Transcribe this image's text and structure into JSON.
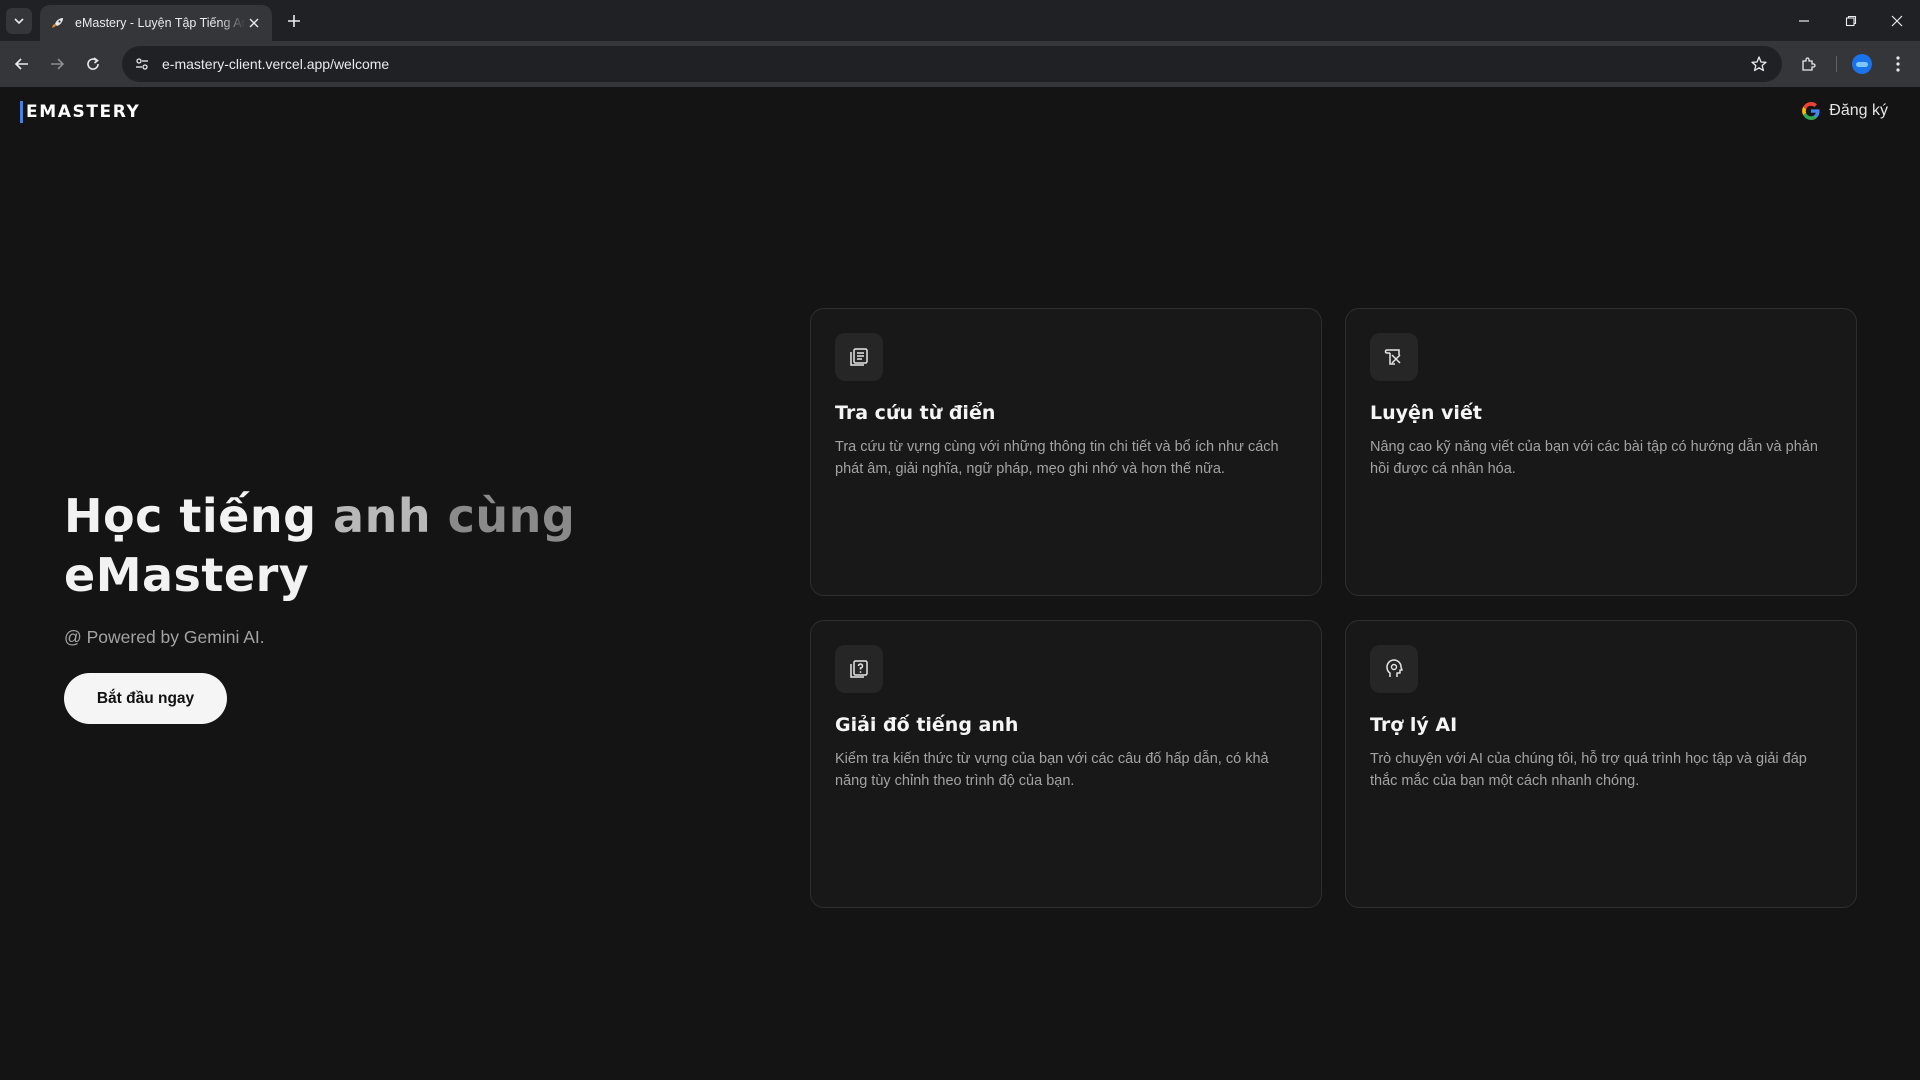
{
  "browser": {
    "tab_title": "eMastery - Luyện Tập Tiếng Anh",
    "url": "e-mastery-client.vercel.app/welcome"
  },
  "header": {
    "logo": "EMASTERY",
    "signup_label": "Đăng ký"
  },
  "hero": {
    "title_part1": "Học tiếng ",
    "title_part2": "anh ",
    "title_part3": "cùng",
    "title_line2": "eMastery",
    "powered": "@ Powered by Gemini AI.",
    "cta_label": "Bắt đầu ngay"
  },
  "features": [
    {
      "icon": "dictionary-icon",
      "title": "Tra cứu từ điển",
      "desc": "Tra cứu từ vựng cùng với những thông tin chi tiết và bổ ích như cách phát âm, giải nghĩa, ngữ pháp, mẹo ghi nhớ và hơn thế nữa."
    },
    {
      "icon": "writing-icon",
      "title": "Luyện viết",
      "desc": "Nâng cao kỹ năng viết của bạn với các bài tập có hướng dẫn và phản hồi được cá nhân hóa."
    },
    {
      "icon": "quiz-icon",
      "title": "Giải đố tiếng anh",
      "desc": "Kiểm tra kiến thức từ vựng của bạn với các câu đố hấp dẫn, có khả năng tùy chỉnh theo trình độ của bạn."
    },
    {
      "icon": "ai-assistant-icon",
      "title": "Trợ lý AI",
      "desc": "Trò chuyện với AI của chúng tôi, hỗ trợ quá trình học tập và giải đáp thắc mắc của bạn một cách nhanh chóng."
    }
  ]
}
